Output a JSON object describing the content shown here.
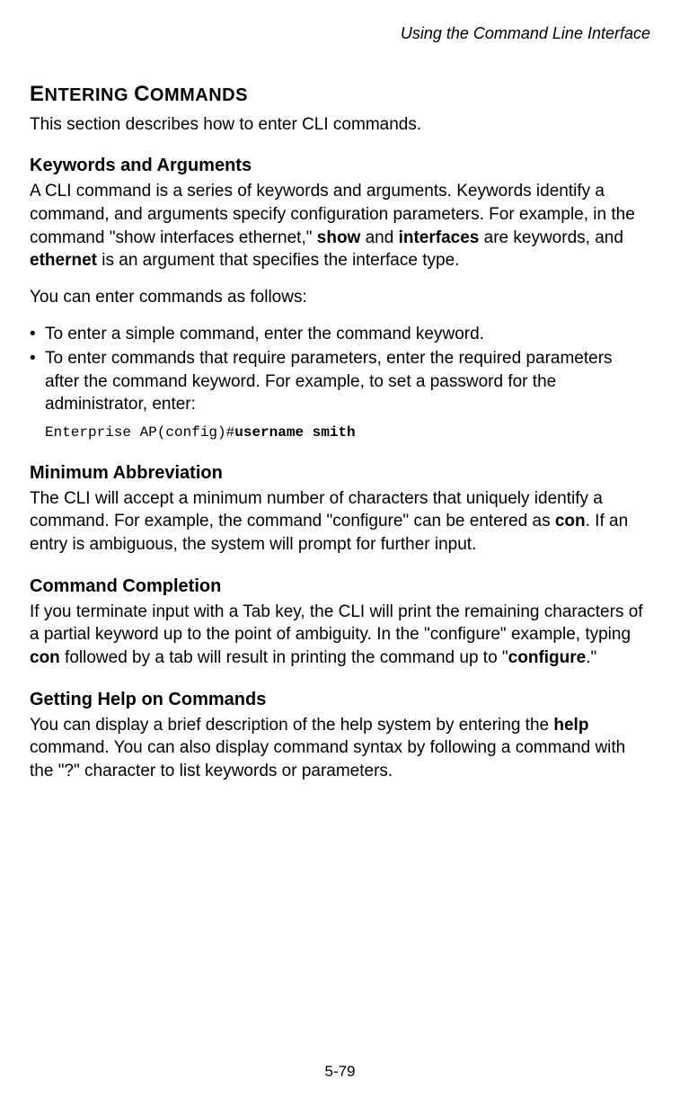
{
  "header": {
    "running_title": "Using the Command Line Interface"
  },
  "section": {
    "title": "ENTERING COMMANDS",
    "intro": "This section describes how to enter CLI commands."
  },
  "keywords_arguments": {
    "heading": "Keywords and Arguments",
    "para1_part1": "A CLI command is a series of keywords and arguments. Keywords identify a command, and arguments specify configuration parameters. For example, in the command \"show interfaces ethernet,\" ",
    "para1_bold1": "show",
    "para1_between1": " and ",
    "para1_bold2": "interfaces",
    "para1_between2": " are keywords, and ",
    "para1_bold3": "ethernet",
    "para1_end": " is an argument that specifies the interface type.",
    "para2": "You can enter commands as follows:",
    "bullet1": "To enter a simple command, enter the command keyword.",
    "bullet2": "To enter commands that require parameters, enter the required parameters after the command keyword. For example, to set a password for the administrator, enter:",
    "code_prefix": "Enterprise AP(config)#",
    "code_bold": "username smith"
  },
  "min_abbrev": {
    "heading": "Minimum Abbreviation",
    "para_part1": "The CLI will accept a minimum number of characters that uniquely identify a command. For example, the command \"configure\" can be entered as ",
    "para_bold": "con",
    "para_end": ". If an entry is ambiguous, the system will prompt for further input."
  },
  "cmd_completion": {
    "heading": "Command Completion",
    "para_part1": "If you terminate input with a Tab key, the CLI will print the remaining characters of a partial keyword up to the point of ambiguity. In the \"configure\" example, typing ",
    "para_bold1": "con",
    "para_between": " followed by a tab will result in printing the command up to \"",
    "para_bold2": "configure",
    "para_end": ".\""
  },
  "getting_help": {
    "heading": "Getting Help on Commands",
    "para_part1": "You can display a brief description of the help system by entering the ",
    "para_bold": "help",
    "para_end": " command. You can also display command syntax by following a command with the \"?\" character to list keywords or parameters."
  },
  "footer": {
    "page_number": "5-79"
  }
}
